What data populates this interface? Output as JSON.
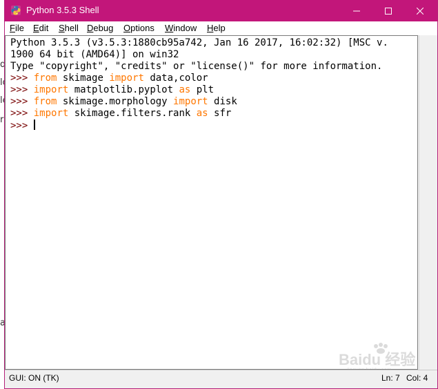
{
  "window": {
    "title": "Python 3.5.3 Shell",
    "accent": "#c2167a"
  },
  "menu": {
    "items": [
      {
        "label": "File",
        "mnemonic": "F",
        "rest": "ile"
      },
      {
        "label": "Edit",
        "mnemonic": "E",
        "rest": "dit"
      },
      {
        "label": "Shell",
        "mnemonic": "S",
        "rest": "hell"
      },
      {
        "label": "Debug",
        "mnemonic": "D",
        "rest": "ebug"
      },
      {
        "label": "Options",
        "mnemonic": "O",
        "rest": "ptions"
      },
      {
        "label": "Window",
        "mnemonic": "W",
        "rest": "indow"
      },
      {
        "label": "Help",
        "mnemonic": "H",
        "rest": "elp"
      }
    ]
  },
  "shell": {
    "banner_1": "Python 3.5.3 (v3.5.3:1880cb95a742, Jan 16 2017, 16:02:32) [MSC v.",
    "banner_2": "1900 64 bit (AMD64)] on win32",
    "banner_3": "Type \"copyright\", \"credits\" or \"license()\" for more information.",
    "prompt": ">>>",
    "lines": [
      {
        "kw1": "from",
        "mid": " skimage ",
        "kw2": "import",
        "tail": " data,color"
      },
      {
        "kw1": "import",
        "mid": " matplotlib.pyplot ",
        "kw2": "as",
        "tail": " plt"
      },
      {
        "kw1": "from",
        "mid": " skimage.morphology ",
        "kw2": "import",
        "tail": " disk"
      },
      {
        "kw1": "import",
        "mid": " skimage.filters.rank ",
        "kw2": "as",
        "tail": " sfr"
      }
    ]
  },
  "status": {
    "gui": "GUI: ON (TK)",
    "ln": "Ln: 7",
    "col": "Col: 4"
  },
  "watermark": {
    "text": "Bai​du 经验",
    "sub": "jingyan.baidu.com"
  },
  "background_fragments": [
    "d",
    "lo",
    "le",
    "r",
    "a"
  ]
}
